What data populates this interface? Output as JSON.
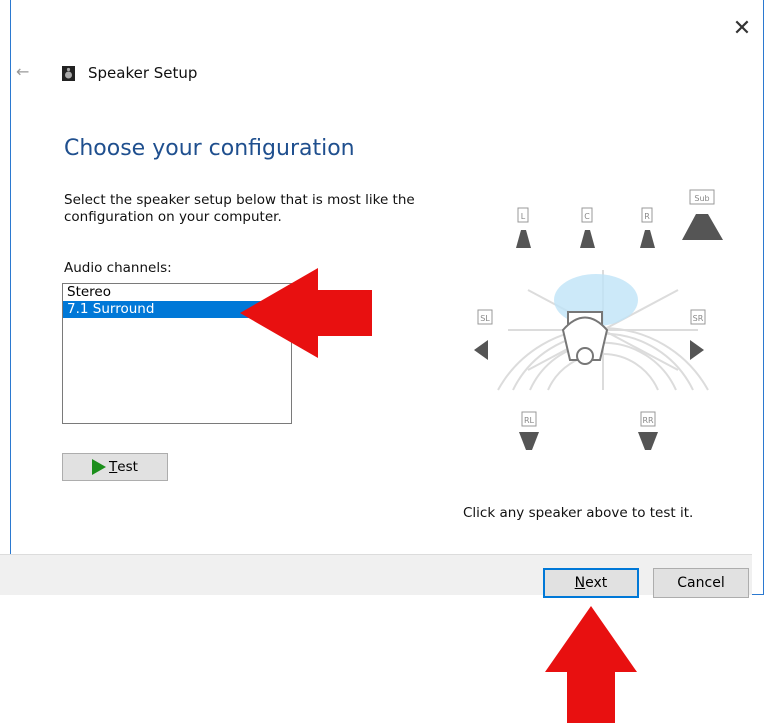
{
  "window": {
    "title": "Speaker Setup",
    "close_label": "✕",
    "back_label": "←"
  },
  "heading": "Choose your configuration",
  "description": "Select the speaker setup below that is most like the configuration on your computer.",
  "channels": {
    "label": "Audio channels:",
    "items": [
      {
        "label": "Stereo",
        "selected": false
      },
      {
        "label": "7.1 Surround",
        "selected": true
      }
    ]
  },
  "test_button": {
    "label_first": "T",
    "label_rest": "est"
  },
  "speakers": {
    "front_left": "L",
    "center": "C",
    "front_right": "R",
    "subwoofer": "Sub",
    "side_left": "SL",
    "side_right": "SR",
    "rear_left": "RL",
    "rear_right": "RR"
  },
  "hint": "Click any speaker above to test it.",
  "footer": {
    "next_first": "N",
    "next_rest": "ext",
    "cancel": "Cancel"
  },
  "colors": {
    "accent": "#0078d7",
    "heading": "#1f4f8e",
    "annotation_arrow": "#e81010"
  }
}
